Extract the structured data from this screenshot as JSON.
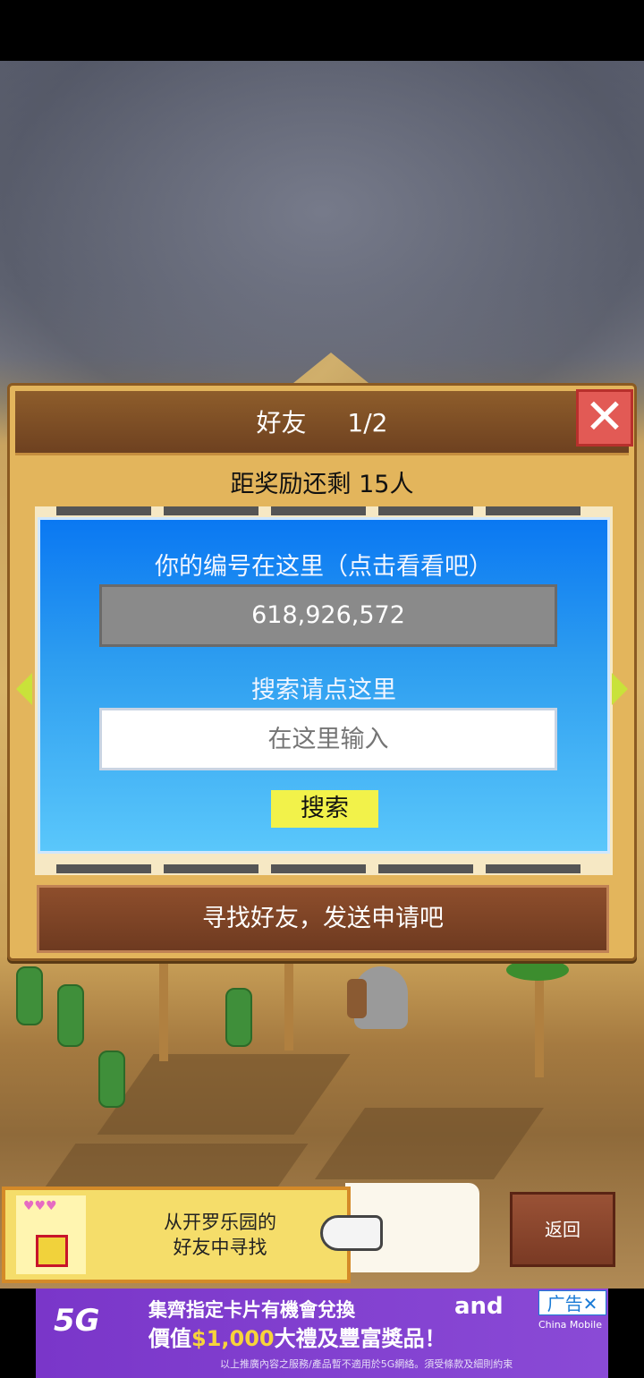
{
  "dialog": {
    "title": "好友",
    "page": "1/2",
    "close_glyph": "✕",
    "reward_text": "距奖励还剩 15人",
    "id_label": "你的编号在这里（点击看看吧）",
    "id_value": "618,926,572",
    "search_label": "搜索请点这里",
    "search_placeholder": "在这里输入",
    "search_button": "搜索",
    "find_button": "寻找好友，发送申请吧"
  },
  "hint": {
    "line1": "从开罗乐园的",
    "line2": "好友中寻找",
    "hearts": "♥♥♥"
  },
  "back_button": "返回",
  "ad": {
    "badge": "5G",
    "line1": "集齊指定卡片有機會兌換",
    "line2_prefix": "價值",
    "line2_amount": "$1,000",
    "line2_suffix": "大禮及豐富獎品！",
    "fine_print": "以上推廣內容之服務/產品暫不適用於5G網絡。須受條款及細則約束",
    "brand": "and",
    "operator": "China Mobile",
    "tag": "广告✕"
  },
  "colors": {
    "panel_top": "#0a78f2",
    "panel_bottom": "#5ac7fb",
    "dialog_bg": "#e3b55c",
    "title_bar": "#6e4120",
    "close": "#e25a55",
    "search_button": "#f2f24a",
    "find_button": "#7a3f22",
    "ad_bg": "#8440d0"
  }
}
